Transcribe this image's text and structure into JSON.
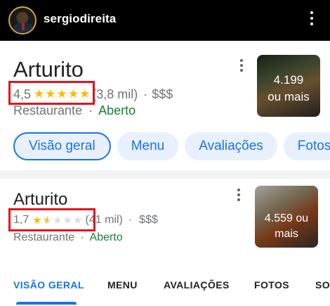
{
  "post_header": {
    "username": "sergiodireita"
  },
  "result1": {
    "name": "Arturito",
    "rating": "4,5",
    "rating_value": 4.5,
    "stars": "★★★★★",
    "reviews": "(3,8 mil)",
    "separator": "·",
    "price": "$$$",
    "category": "Restaurante",
    "status": "Aberto",
    "photo_count_line1": "4.199",
    "photo_count_line2": "ou mais",
    "chips": [
      "Visão geral",
      "Menu",
      "Avaliações",
      "Fotos"
    ]
  },
  "result2": {
    "name": "Arturito",
    "rating": "1,7",
    "rating_value": 1.7,
    "stars_on": "★",
    "stars_half": "★",
    "stars_off": "★★★",
    "reviews": "(41 mil)",
    "separator": "·",
    "price": "$$$",
    "category": "Restaurante",
    "status": "Aberto",
    "photo_count_line1": "4.559 ou",
    "photo_count_line2": "mais",
    "tabs": [
      "VISÃO GERAL",
      "MENU",
      "AVALIAÇÕES",
      "FOTOS",
      "SO"
    ]
  },
  "colors": {
    "highlight_box": "#e0141d",
    "star": "#fbbc04",
    "open": "#188038",
    "accent": "#1a73e8"
  }
}
